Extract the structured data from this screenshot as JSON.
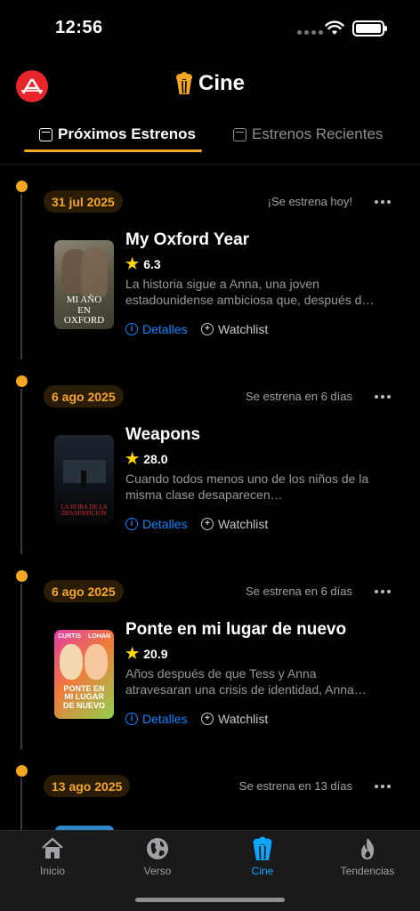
{
  "status_bar": {
    "time": "12:56"
  },
  "header": {
    "title": "Cine"
  },
  "tabs": [
    {
      "label": "Próximos Estrenos",
      "active": true
    },
    {
      "label": "Estrenos Recientes",
      "active": false
    }
  ],
  "releases": [
    {
      "date": "31 jul 2025",
      "status": "¡Se estrena hoy!",
      "title": "My Oxford Year",
      "rating": "6.3",
      "synopsis": "La historia sigue a Anna, una joven estadounidense ambiciosa que, después de mudarse a Oxford...",
      "poster_text": "MI AÑO EN OXFORD"
    },
    {
      "date": "6 ago 2025",
      "status": "Se estrena en 6 días",
      "title": "Weapons",
      "rating": "28.0",
      "synopsis": "Cuando todos menos uno de los niños de la misma clase desaparecen misteriosamente...",
      "poster_text": "LA HORA DE LA DESAPARICIÓN"
    },
    {
      "date": "6 ago 2025",
      "status": "Se estrena en 6 días",
      "title": "Ponte en mi lugar de nuevo",
      "rating": "20.9",
      "synopsis": "Años después de que Tess y Anna atravesaran una crisis de identidad, Anna a...",
      "poster_text": "PONTE EN MI LUGAR DE NUEVO",
      "poster_names": [
        "CURTIS",
        "LOHAN"
      ]
    },
    {
      "date": "13 ago 2025",
      "status": "Se estrena en 13 días"
    }
  ],
  "actions": {
    "details_label": "Detalles",
    "watchlist_label": "Watchlist"
  },
  "bottom_nav": [
    {
      "label": "Inicio",
      "icon": "home-icon"
    },
    {
      "label": "Verso",
      "icon": "globe-icon"
    },
    {
      "label": "Cine",
      "icon": "popcorn-icon",
      "active": true
    },
    {
      "label": "Tendencias",
      "icon": "flame-icon"
    }
  ],
  "colors": {
    "accent": "#f5a623",
    "link": "#0a84ff",
    "active_nav": "#0aa6ff",
    "logo_red": "#e8252a"
  }
}
